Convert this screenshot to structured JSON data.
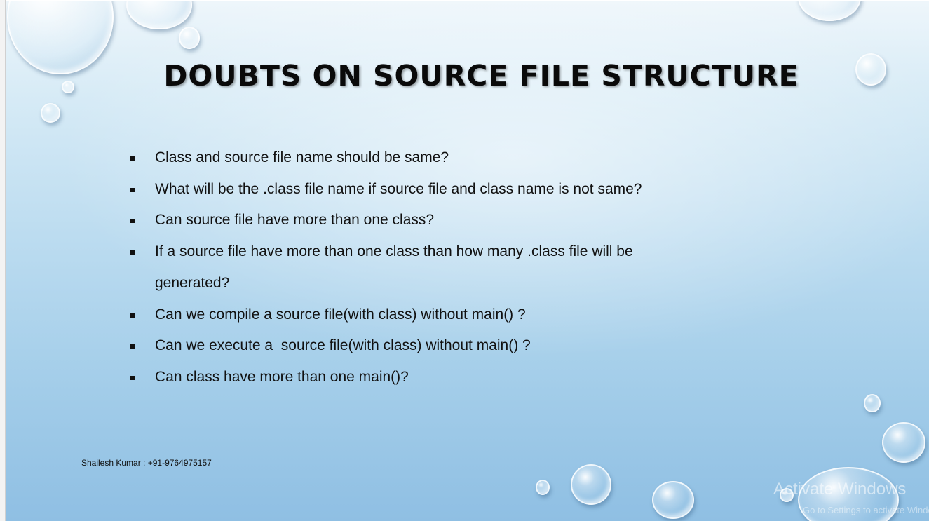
{
  "slide": {
    "title": "DOUBTS ON SOURCE FILE STRUCTURE",
    "bullets": [
      "Class and source file name should be same?",
      "What will be the .class file name if source file and class name is not same?",
      "Can source file have more than one class?",
      "If a source file have more than one class than how many .class file will be generated?",
      "Can we compile a source file(with class) without main() ?",
      "Can we execute a  source file(with class) without main() ?",
      "Can class have more than one main()?"
    ],
    "bullet_icon": "square-bullet-icon",
    "footer": "Shailesh Kumar : +91-9764975157",
    "decoration": "water-drops"
  },
  "watermark": {
    "title": "Activate Windows",
    "subtitle": "Go to Settings to activate Windows."
  },
  "colors": {
    "background_top": "#eef6fb",
    "background_bottom": "#8fbfe3",
    "text": "#111111"
  }
}
